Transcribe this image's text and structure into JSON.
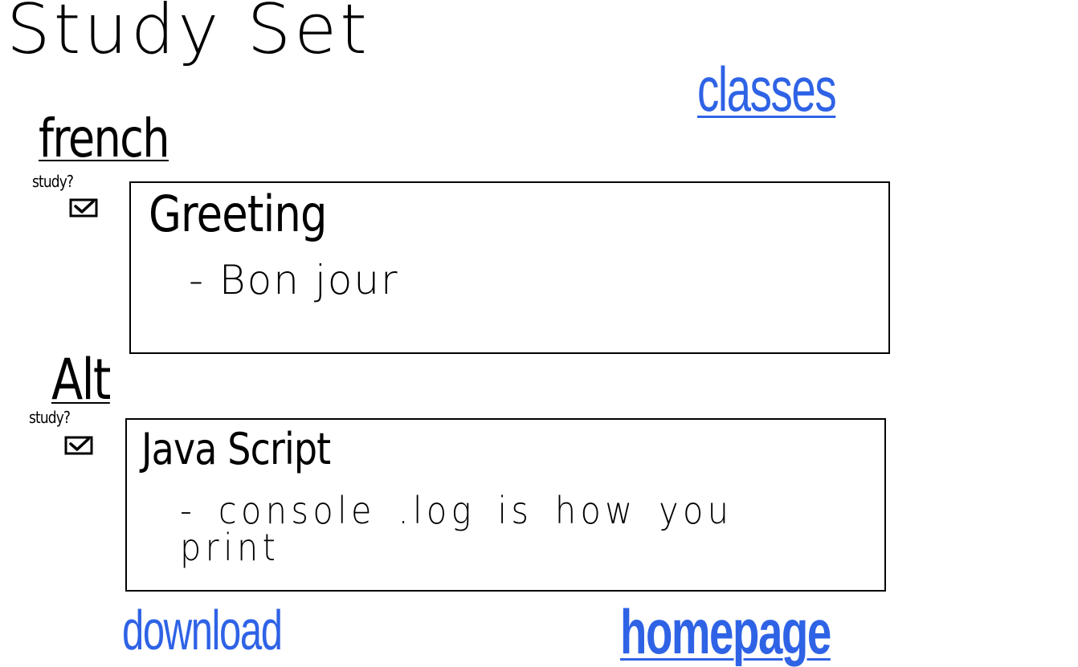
{
  "page": {
    "title": "Study Set"
  },
  "nav": {
    "classes_label": "classes",
    "download_label": "download",
    "homepage_label": "homepage"
  },
  "colors": {
    "link": "#2f63e6",
    "ink": "#000000"
  },
  "sets": [
    {
      "heading": "french",
      "study_label": "study?",
      "checked": true,
      "card": {
        "title": "Greeting",
        "detail": "- Bon jour"
      }
    },
    {
      "heading": "Alt",
      "study_label": "study?",
      "checked": true,
      "card": {
        "title": "Java Script",
        "detail": "- console .log is how you print"
      }
    }
  ]
}
